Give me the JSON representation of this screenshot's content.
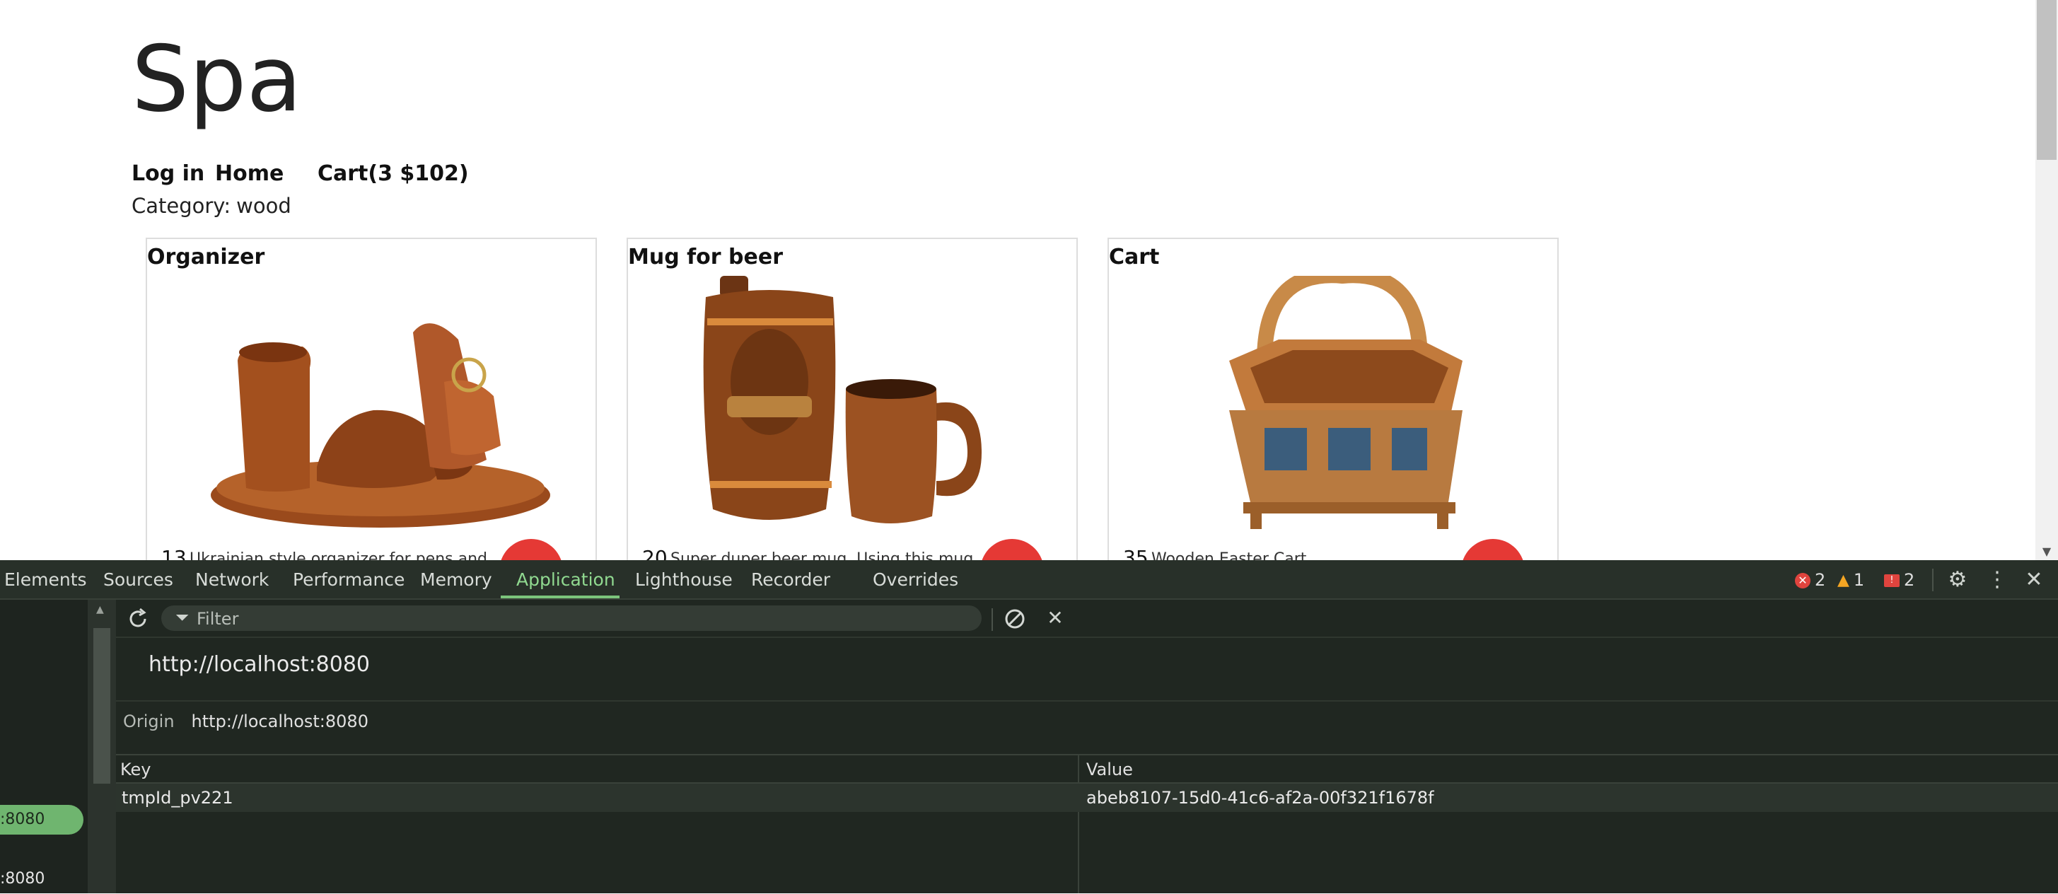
{
  "site": {
    "title": "Spa",
    "nav": {
      "login": "Log in",
      "home": "Home",
      "cart": "Cart(3 $102)"
    },
    "category_label": "Category:",
    "category_value": "wood",
    "products": [
      {
        "title": "Organizer",
        "price": "13",
        "desc": "Ukrainian style organizer for pens and"
      },
      {
        "title": "Mug for beer",
        "price": "20",
        "desc": "Super duper beer mug. Using this mug"
      },
      {
        "title": "Cart",
        "price": "35",
        "desc": "Wooden Easter Cart"
      }
    ],
    "accent_color": "#e53935"
  },
  "devtools": {
    "tabs": [
      "Elements",
      "Sources",
      "Network",
      "Performance",
      "Memory",
      "Application",
      "Lighthouse",
      "Recorder",
      "Overrides"
    ],
    "active_tab": "Application",
    "status": {
      "errors": "2",
      "warnings": "1",
      "issues": "2"
    },
    "sidebar": {
      "selected_item": ":8080",
      "item2": ":8080"
    },
    "filter_placeholder": "Filter",
    "origin_header": "http://localhost:8080",
    "origin_label": "Origin",
    "origin_value": "http://localhost:8080",
    "columns": {
      "key": "Key",
      "value": "Value"
    },
    "rows": [
      {
        "key": "tmpId_pv221",
        "value": "abeb8107-15d0-41c6-af2a-00f321f1678f"
      }
    ],
    "accent_color": "#7cc47c"
  }
}
